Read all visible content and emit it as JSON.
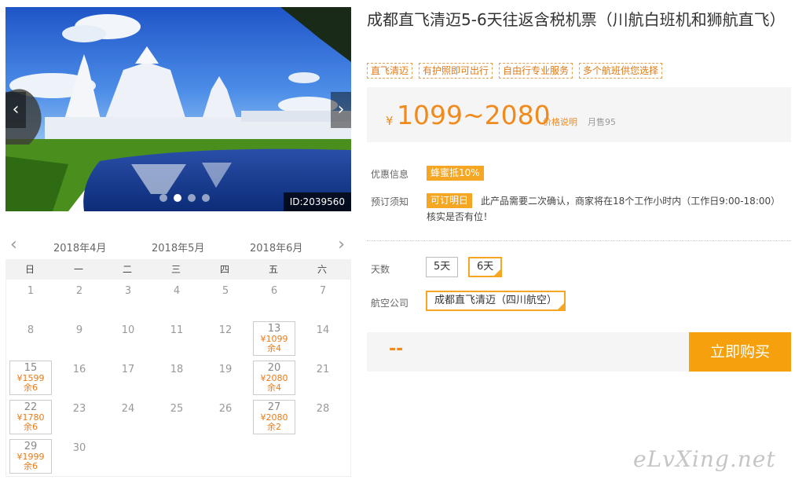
{
  "hero": {
    "id_label": "ID:2039560",
    "prev_icon": "‹",
    "next_icon": "›"
  },
  "product": {
    "title": "成都直飞清迈5-6天往返含税机票（川航白班机和狮航直飞）",
    "tags": [
      "直飞清迈",
      "有护照即可出行",
      "自由行专业服务",
      "多个航班供您选择"
    ],
    "price_symbol": "¥",
    "price_range": "1099~2080",
    "price_note": "价格说明",
    "monthly_sales": "月售95"
  },
  "discount": {
    "label": "优惠信息",
    "badge": "蜂蜜抵10%"
  },
  "booking": {
    "label": "预订须知",
    "badge": "可订明日",
    "text": "此产品需要二次确认，商家将在18个工作小时内（工作日9:00-18:00）核实是否有位！"
  },
  "days": {
    "label": "天数",
    "options": [
      "5天",
      "6天"
    ],
    "selected": "6天"
  },
  "airline": {
    "label": "航空公司",
    "selected": "成都直飞清迈（四川航空）"
  },
  "purchase": {
    "total": "--",
    "button": "立即购买"
  },
  "calendar": {
    "prev_icon": "‹",
    "next_icon": "›",
    "months": [
      "2018年4月",
      "2018年5月",
      "2018年6月"
    ],
    "weekdays": [
      "日",
      "一",
      "二",
      "三",
      "四",
      "五",
      "六"
    ],
    "days": [
      {
        "day": "1"
      },
      {
        "day": "2"
      },
      {
        "day": "3"
      },
      {
        "day": "4"
      },
      {
        "day": "5"
      },
      {
        "day": "6"
      },
      {
        "day": "7"
      },
      {
        "day": "8"
      },
      {
        "day": "9"
      },
      {
        "day": "10"
      },
      {
        "day": "11"
      },
      {
        "day": "12"
      },
      {
        "day": "13",
        "price": "¥1099",
        "remain": "余4"
      },
      {
        "day": "14"
      },
      {
        "day": "15",
        "price": "¥1599",
        "remain": "余6"
      },
      {
        "day": "16"
      },
      {
        "day": "17"
      },
      {
        "day": "18"
      },
      {
        "day": "19"
      },
      {
        "day": "20",
        "price": "¥2080",
        "remain": "余4"
      },
      {
        "day": "21"
      },
      {
        "day": "22",
        "price": "¥1780",
        "remain": "余6"
      },
      {
        "day": "23"
      },
      {
        "day": "24"
      },
      {
        "day": "25"
      },
      {
        "day": "26"
      },
      {
        "day": "27",
        "price": "¥2080",
        "remain": "余2"
      },
      {
        "day": "28"
      },
      {
        "day": "29",
        "price": "¥1999",
        "remain": "余6"
      },
      {
        "day": "30"
      }
    ]
  },
  "watermark": "eLvXing.net",
  "colors": {
    "accent": "#f5a623",
    "price": "#f08a1c",
    "buy_button": "#f5a00c"
  }
}
